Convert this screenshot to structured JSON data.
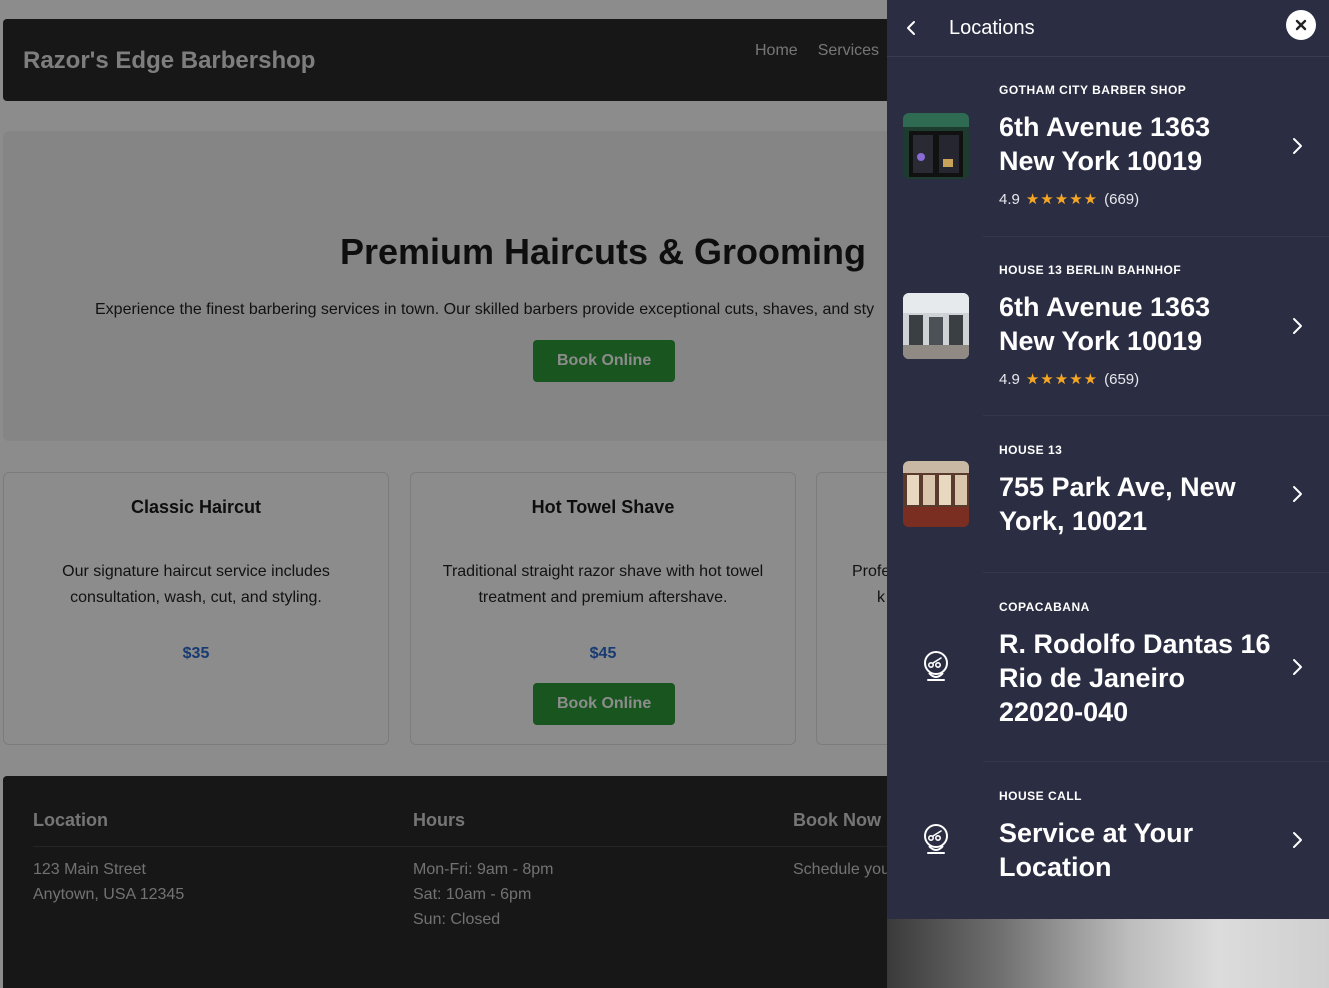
{
  "site": {
    "brand": "Razor's Edge Barbershop",
    "nav": [
      "Home",
      "Services"
    ]
  },
  "hero": {
    "title": "Premium Haircuts & Grooming",
    "subtitle": "Experience the finest barbering services in town. Our skilled barbers provide exceptional cuts, shaves, and sty",
    "cta": "Book Online"
  },
  "services": [
    {
      "title": "Classic Haircut",
      "desc": "Our signature haircut service includes consultation, wash, cut, and styling.",
      "price": "$35"
    },
    {
      "title": "Hot Towel Shave",
      "desc": "Traditional straight razor shave with hot towel treatment and premium aftershave.",
      "price": "$45",
      "cta": "Book Online"
    },
    {
      "desc_partial_1": "Profe",
      "desc_partial_2": "k"
    }
  ],
  "footer": {
    "location": {
      "heading": "Location",
      "line1": "123 Main Street",
      "line2": "Anytown, USA 12345"
    },
    "hours": {
      "heading": "Hours",
      "line1": "Mon-Fri: 9am - 8pm",
      "line2": "Sat: 10am - 6pm",
      "line3": "Sun: Closed"
    },
    "book": {
      "heading": "Book Now",
      "text": "Schedule you"
    }
  },
  "drawer": {
    "title": "Locations",
    "back_icon": "chevron-left-icon",
    "close_icon": "close-icon",
    "locations": [
      {
        "name": "GOTHAM CITY BARBER SHOP",
        "address": "6th Avenue 1363 New York 10019",
        "rating": "4.9",
        "stars": "★★★★★",
        "reviews": "(669)",
        "thumb": "storefront-photo"
      },
      {
        "name": "HOUSE 13 BERLIN BAHNHOF",
        "address": "6th Avenue 1363 New York 10019",
        "rating": "4.9",
        "stars": "★★★★★",
        "reviews": "(659)",
        "thumb": "interior-photo"
      },
      {
        "name": "HOUSE 13",
        "address": "755 Park Ave, New York, 10021",
        "thumb": "shop-photo"
      },
      {
        "name": "COPACABANA",
        "address": "R. Rodolfo Dantas 16 Rio de Janeiro 22020-040",
        "icon": "barber-head-icon"
      },
      {
        "name": "HOUSE CALL",
        "address": "Service at Your Location",
        "icon": "barber-head-icon"
      }
    ]
  }
}
